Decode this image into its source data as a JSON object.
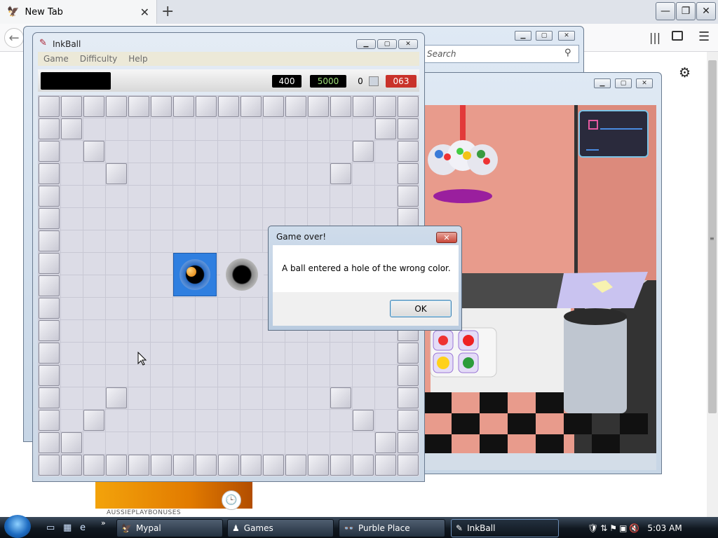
{
  "browser": {
    "tab_title": "New Tab",
    "tab_close": "✕",
    "new_tab": "+",
    "back": "←",
    "menu": "☰",
    "library": "|||",
    "settings_glyph": "⚙",
    "window_min": "—",
    "window_max": "❐",
    "window_close": "✕"
  },
  "mypal_window": {
    "search_placeholder": "Search",
    "search_icon": "⚲"
  },
  "inkball": {
    "title": "InkBall",
    "menu": [
      "Game",
      "Difficulty",
      "Help"
    ],
    "score": "400",
    "target_score": "5000",
    "balls_remaining": "0",
    "timer": "063"
  },
  "dialog": {
    "title": "Game over!",
    "message": "A ball entered a hole of the wrong color.",
    "ok_label": "OK",
    "close_glyph": "✕"
  },
  "ad": {
    "caption": "AUSSIEPLAYBONUSES"
  },
  "taskbar": {
    "items": [
      "Mypal",
      "Games",
      "Purble Place",
      "InkBall"
    ],
    "clock": "5:03 AM",
    "more": "»"
  },
  "colors": {
    "timer_red": "#c9322a",
    "target_green": "#9fe07a",
    "hole_blue": "#2f7fe0",
    "ball_orange": "#e07a00"
  }
}
